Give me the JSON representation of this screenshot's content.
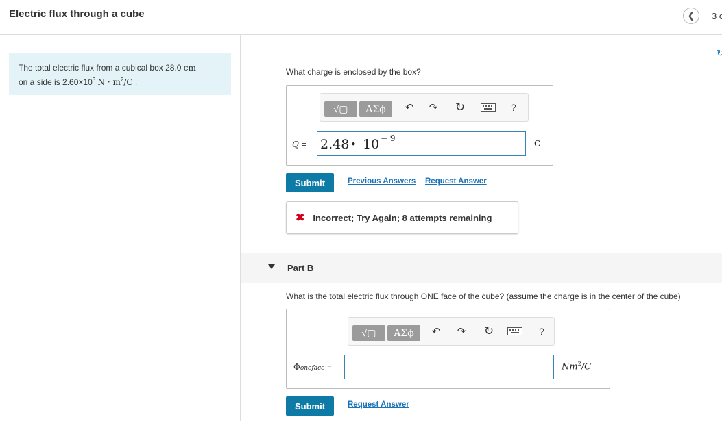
{
  "header": {
    "title": "Electric flux through a cube",
    "page_indicator": "3 o"
  },
  "problem": {
    "text_a": "The total electric flux from a cubical box 28.0 ",
    "unit_a": "cm",
    "text_b": "on a side is 2.60×10",
    "exp_b": "3",
    "unit_b": "N · m",
    "exp_c": "2",
    "unit_c": "/C",
    "period": "."
  },
  "part_a": {
    "question": "What charge is enclosed by the box?",
    "toolbar": {
      "template_glyph": "√▢",
      "greek": "ΑΣϕ",
      "help": "?"
    },
    "var_label": "Q",
    "equals": "=",
    "answer_mantissa": "2.48",
    "answer_dot": "•",
    "answer_base": "10",
    "answer_exp": "− 9",
    "unit": "C",
    "submit": "Submit",
    "previous_answers": "Previous Answers",
    "request_answer": "Request Answer",
    "feedback": "Incorrect; Try Again; 8 attempts remaining"
  },
  "part_b": {
    "label": "Part B",
    "question": "What is the total electric flux through ONE face of the cube? (assume the charge is in the center of the cube)",
    "toolbar": {
      "template_glyph": "√▢",
      "greek": "ΑΣϕ",
      "help": "?"
    },
    "var_symbol": "Φ",
    "var_sub": "oneface",
    "equals": "=",
    "answer_value": "",
    "unit_main": "Nm",
    "unit_exp": "2",
    "unit_tail": "/C",
    "submit": "Submit",
    "request_answer": "Request Answer"
  },
  "colors": {
    "accent": "#0e7aa6",
    "link": "#1a73b8",
    "error": "#d0021b",
    "problem_bg": "#e4f3f8"
  }
}
